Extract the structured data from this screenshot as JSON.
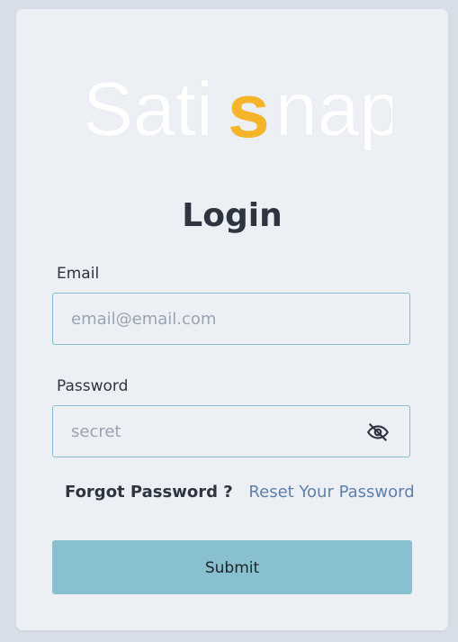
{
  "logo": {
    "text_left": "Sati",
    "text_mid": "s",
    "text_right": "nap",
    "accent_color": "#f5b429",
    "text_color": "#ffffff"
  },
  "form": {
    "title": "Login",
    "email_label": "Email",
    "email_placeholder": "email@email.com",
    "password_label": "Password",
    "password_placeholder": "secret",
    "password_toggle_icon": "eye-slash-icon",
    "forgot_text": "Forgot Password ?",
    "reset_link": "Reset Your Password",
    "submit_label": "Submit"
  },
  "colors": {
    "background": "#d9dfe8",
    "card": "#eceff4",
    "primary_button": "#88c0d0",
    "link": "#5e81ac",
    "input_border": "#88bdd0"
  }
}
